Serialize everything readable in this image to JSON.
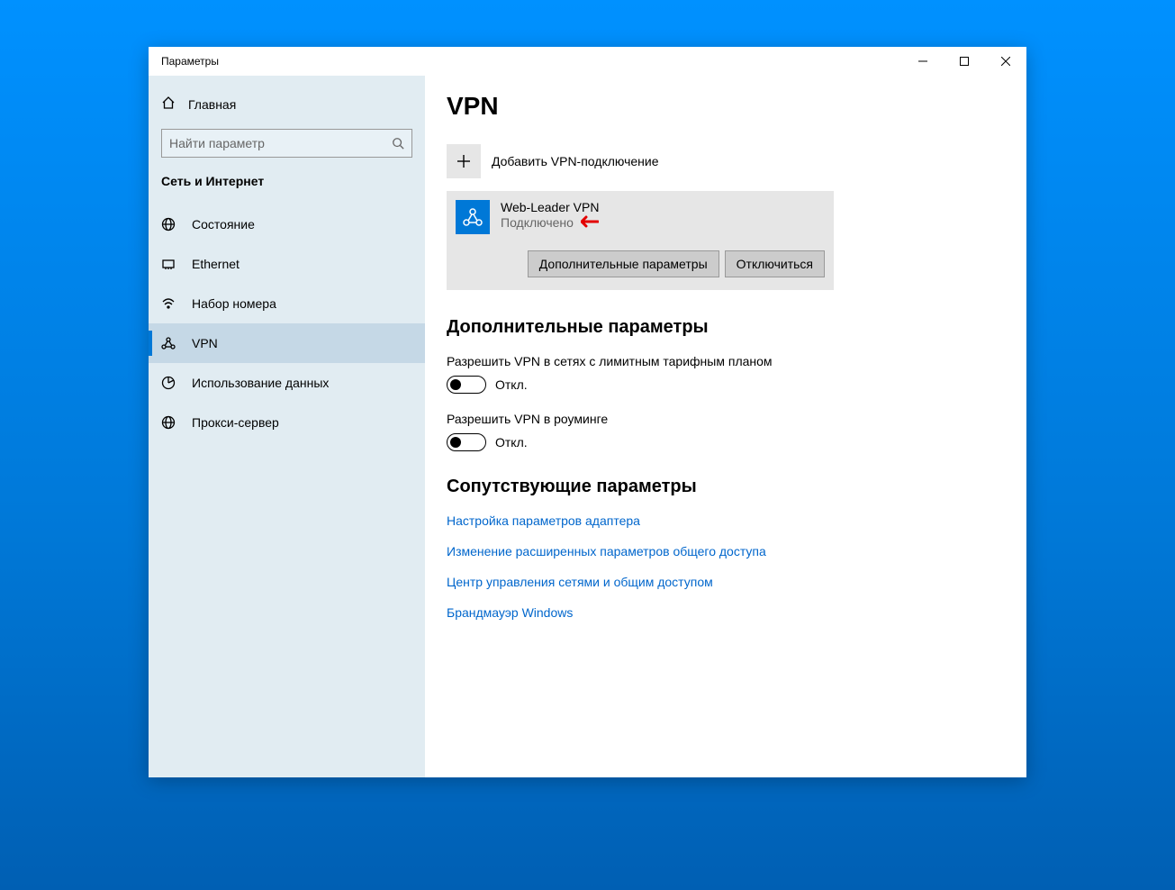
{
  "window": {
    "title": "Параметры"
  },
  "sidebar": {
    "home_label": "Главная",
    "search_placeholder": "Найти параметр",
    "category_label": "Сеть и Интернет",
    "items": [
      {
        "label": "Состояние"
      },
      {
        "label": "Ethernet"
      },
      {
        "label": "Набор номера"
      },
      {
        "label": "VPN"
      },
      {
        "label": "Использование данных"
      },
      {
        "label": "Прокси-сервер"
      }
    ]
  },
  "main": {
    "page_title": "VPN",
    "add_label": "Добавить VPN-подключение",
    "vpn_item": {
      "name": "Web-Leader VPN",
      "status": "Подключено",
      "advanced_button": "Дополнительные параметры",
      "disconnect_button": "Отключиться"
    },
    "advanced_heading": "Дополнительные параметры",
    "settings": [
      {
        "label": "Разрешить VPN в сетях с лимитным тарифным планом",
        "state": "Откл."
      },
      {
        "label": "Разрешить VPN в роуминге",
        "state": "Откл."
      }
    ],
    "related_heading": "Сопутствующие параметры",
    "links": [
      "Настройка параметров адаптера",
      "Изменение расширенных параметров общего доступа",
      "Центр управления сетями и общим доступом",
      "Брандмауэр Windows"
    ]
  }
}
